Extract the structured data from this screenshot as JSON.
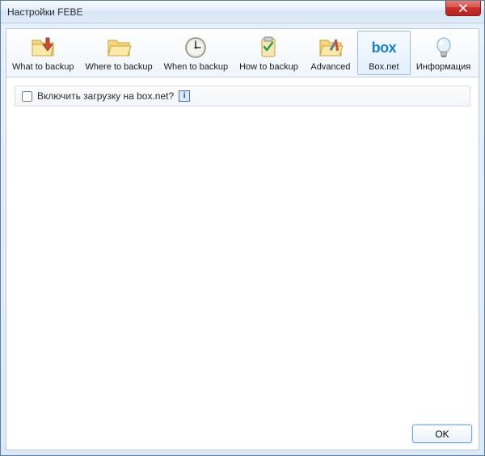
{
  "window": {
    "title": "Настройки FEBE"
  },
  "toolbar": {
    "items": [
      {
        "label": "What to backup"
      },
      {
        "label": "Where to backup"
      },
      {
        "label": "When to backup"
      },
      {
        "label": "How to backup"
      },
      {
        "label": "Advanced"
      },
      {
        "label": "Box.net"
      },
      {
        "label": "Информация"
      }
    ],
    "active_index": 5
  },
  "option": {
    "label": "Включить загрузку на box.net?",
    "checked": false,
    "info_symbol": "i"
  },
  "footer": {
    "ok_label": "OK"
  }
}
